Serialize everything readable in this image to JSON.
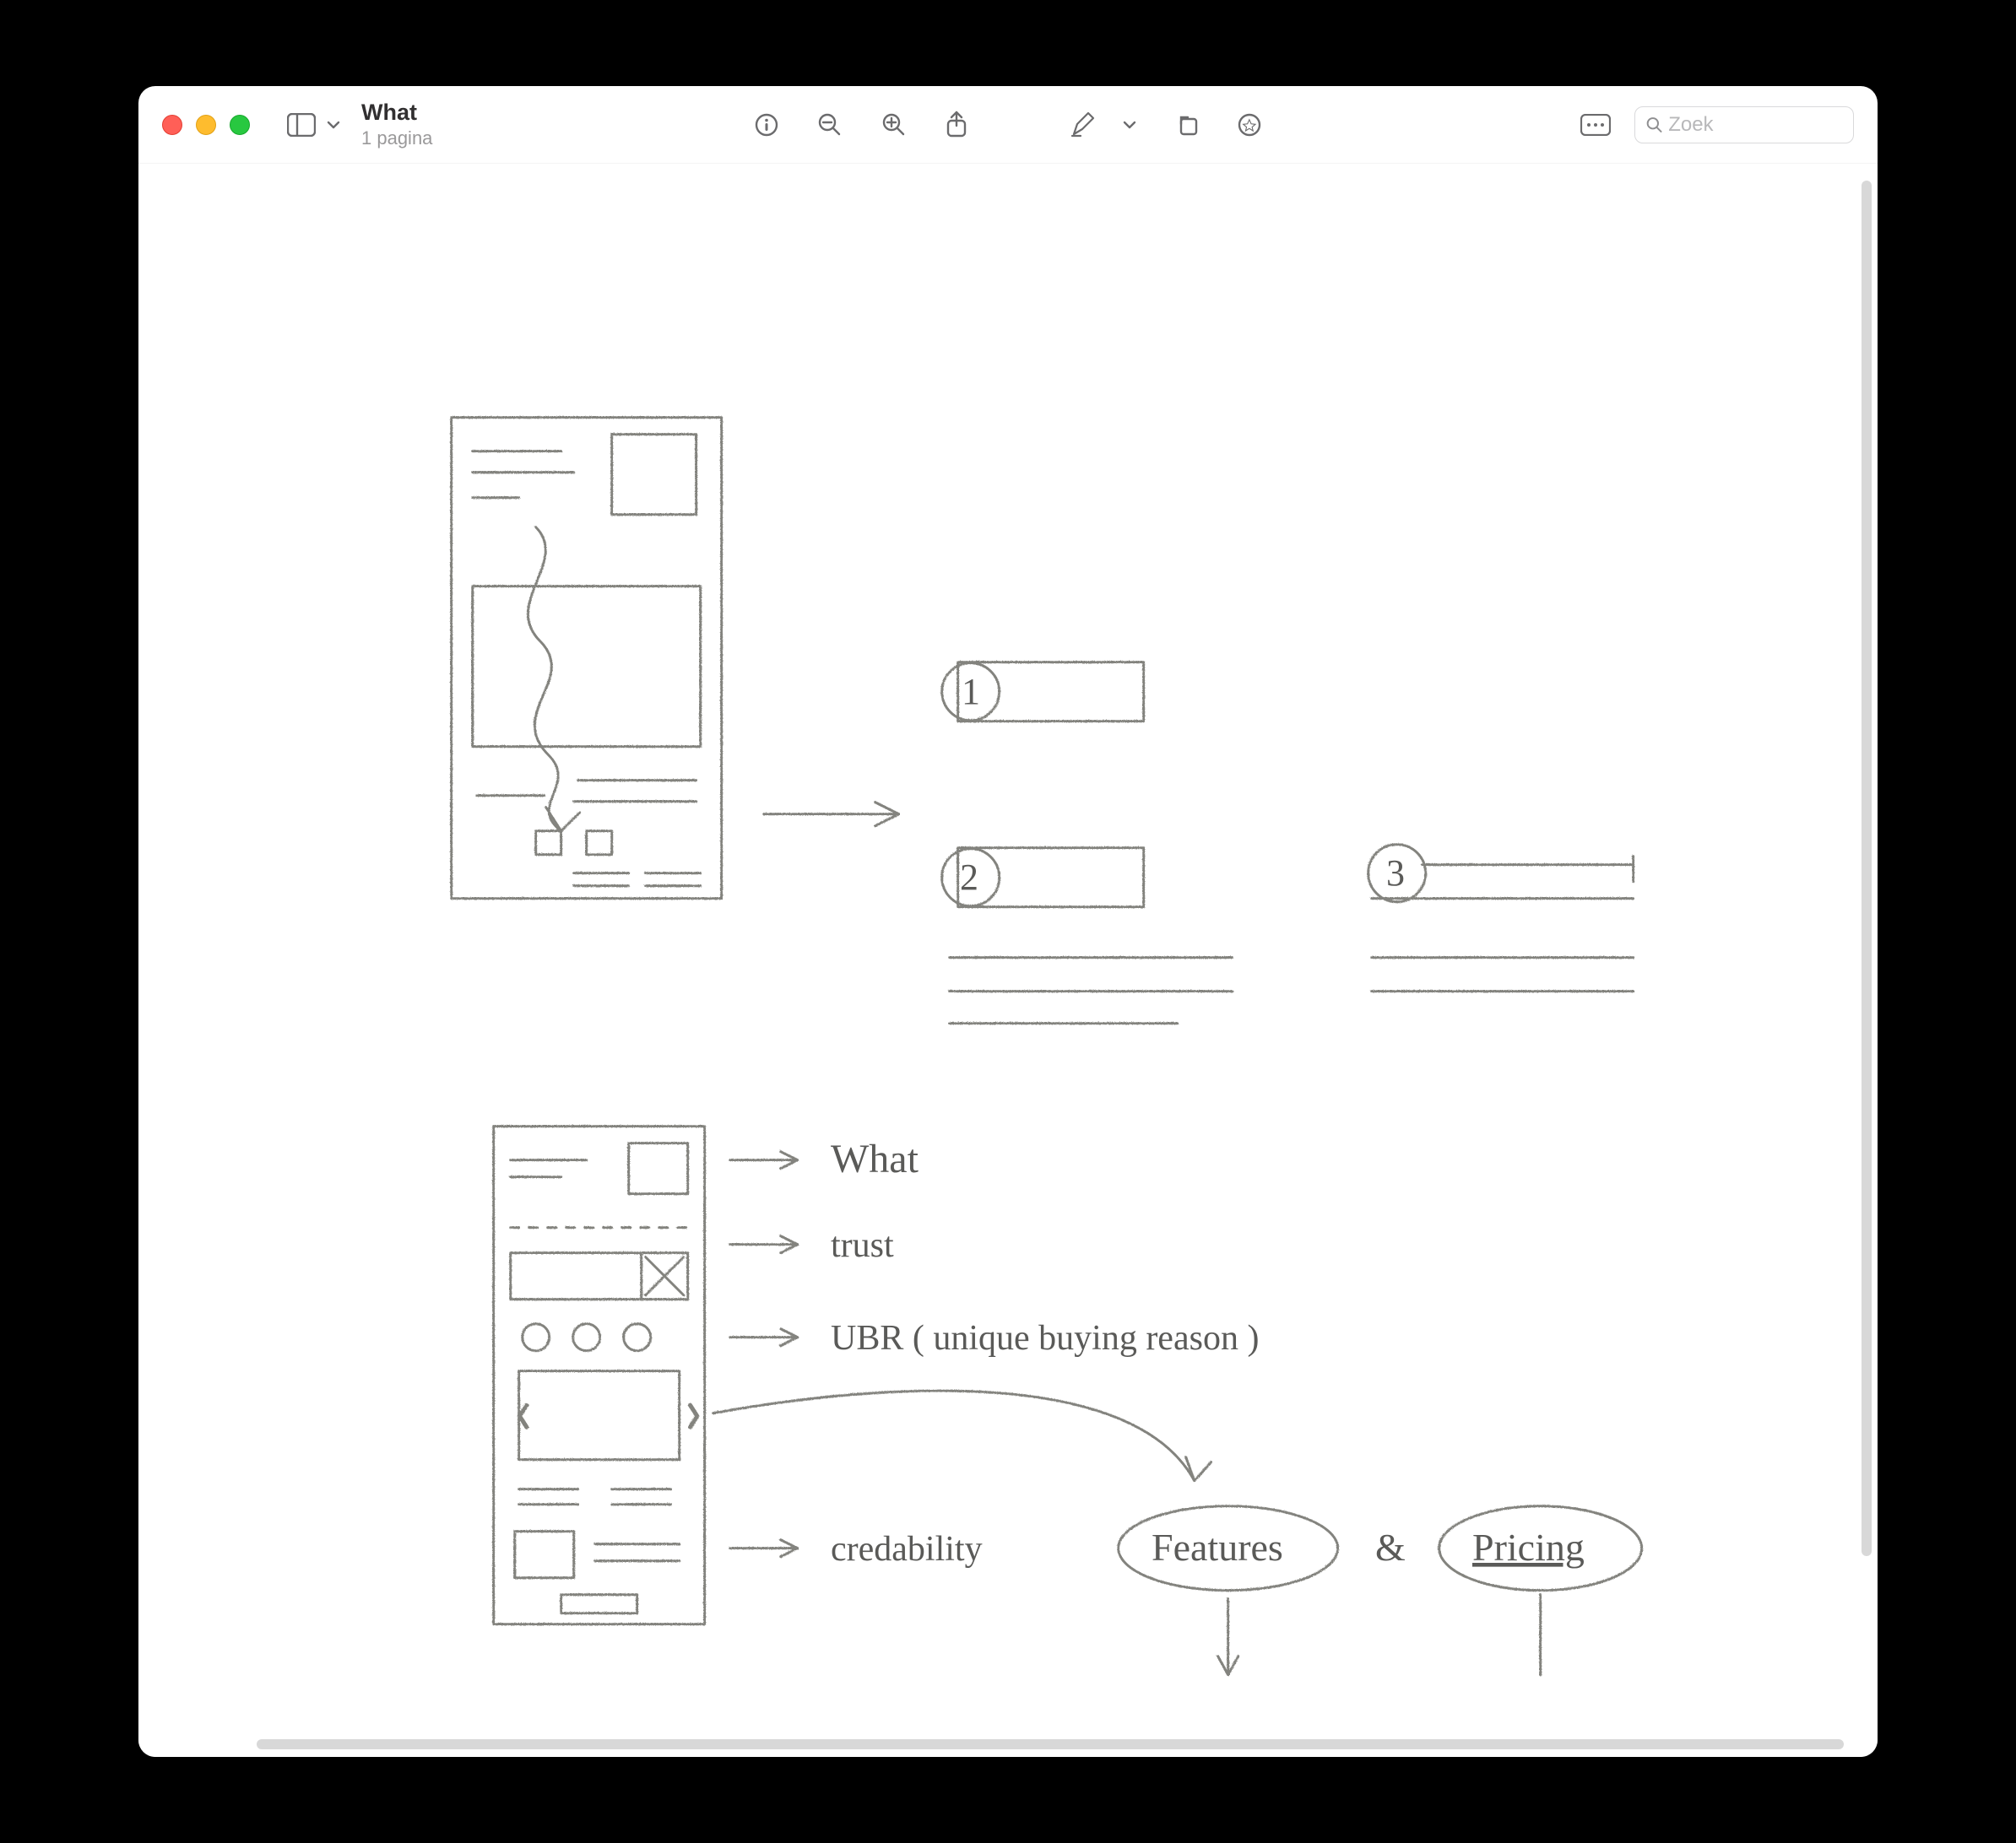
{
  "window": {
    "title": "What",
    "subtitle": "1 pagina"
  },
  "search": {
    "placeholder": "Zoek"
  },
  "sketch": {
    "steps": [
      "1",
      "2",
      "3"
    ],
    "annotations": {
      "what": "What",
      "trust": "trust",
      "ubr": "UBR  ( unique  buying  reason )",
      "credibility": "credability"
    },
    "bubbles": {
      "features": "Features",
      "amp": "&",
      "pricing": "Pricing"
    }
  },
  "icons": {
    "sidebar": "sidebar-icon",
    "chevron": "chevron-down-icon",
    "info": "info-icon",
    "zoomOut": "zoom-out-icon",
    "zoomIn": "zoom-in-icon",
    "share": "share-icon",
    "markup": "markup-pencil-icon",
    "rotate": "rotate-icon",
    "highlight": "highlight-icon",
    "ellipsis": "thumbnails-icon",
    "searchGlass": "search-icon"
  }
}
